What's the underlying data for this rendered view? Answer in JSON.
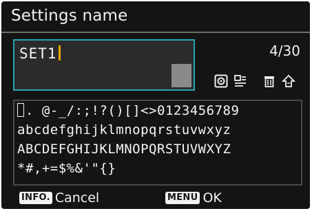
{
  "header": {
    "title": "Settings name"
  },
  "name_input": {
    "value": "SET1"
  },
  "counter": {
    "text": "4/30"
  },
  "mode_icons": [
    "record-delete-icon",
    "input-mode-icon",
    "trash-icon",
    "shift-icon"
  ],
  "character_palette": {
    "rows": [
      ". @-_/:;!?()[]<>0123456789",
      "abcdefghijklmnopqrstuvwxyz",
      "ABCDEFGHIJKLMNOPQRSTUVWXYZ",
      "*#,+=$%&'\"{}"
    ]
  },
  "footer": {
    "info_key": "INFO.",
    "info_label": "Cancel",
    "menu_key": "MENU",
    "menu_label": "OK"
  },
  "colors": {
    "background": "#141414",
    "accent_border": "#2aa6b4",
    "cursor": "#e8a800",
    "text": "#f2f2f2"
  }
}
